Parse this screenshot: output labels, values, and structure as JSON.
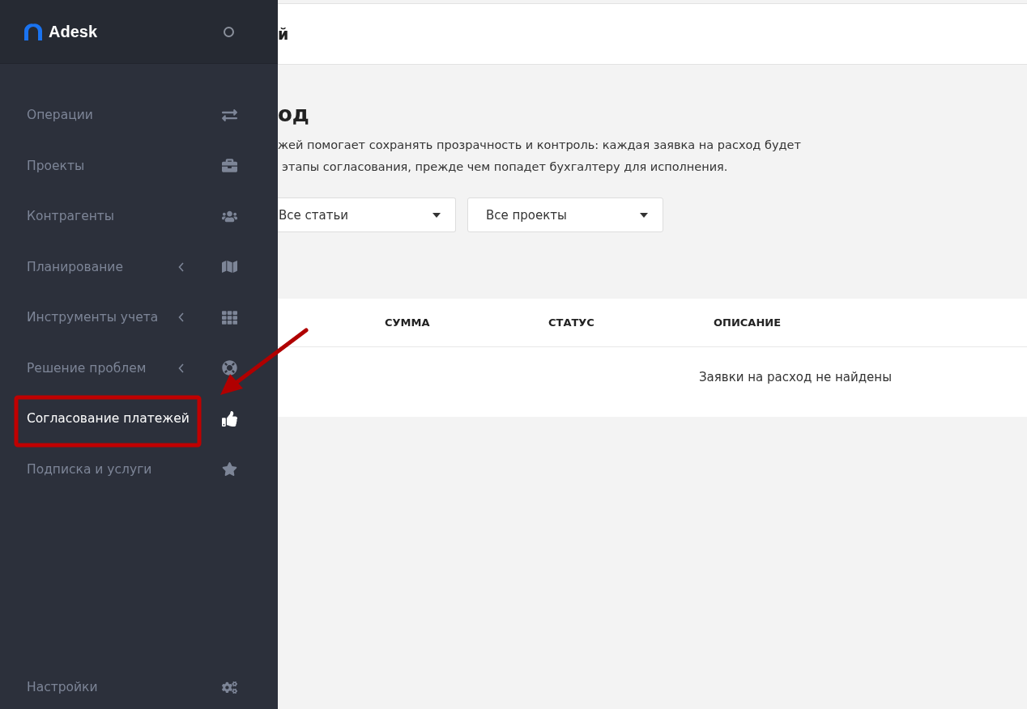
{
  "sidebar": {
    "logo": "Adesk",
    "items": [
      {
        "label": "Операции",
        "has_submenu": false,
        "selected": false
      },
      {
        "label": "Проекты",
        "has_submenu": false,
        "selected": false
      },
      {
        "label": "Контрагенты",
        "has_submenu": false,
        "selected": false
      },
      {
        "label": "Планирование",
        "has_submenu": true,
        "selected": false
      },
      {
        "label": "Инструменты учета",
        "has_submenu": true,
        "selected": false
      },
      {
        "label": "Решение проблем",
        "has_submenu": true,
        "selected": false
      },
      {
        "label": "Согласование платежей",
        "has_submenu": false,
        "selected": true
      },
      {
        "label": "Подписка и услуги",
        "has_submenu": false,
        "selected": false
      }
    ],
    "footer_item": {
      "label": "Настройки"
    }
  },
  "header": {
    "title": "й"
  },
  "page": {
    "title": "од",
    "description": [
      "жей помогает сохранять прозрачность и контроль: каждая заявка на расход будет",
      "этапы согласования, прежде чем попадет бухгалтеру для исполнения."
    ]
  },
  "filters": [
    {
      "value": "Все статьи"
    },
    {
      "value": "Все проекты"
    }
  ],
  "table": {
    "columns": [
      "СУММА",
      "СТАТУС",
      "ОПИСАНИЕ"
    ],
    "empty_message": "Заявки на расход не найдены"
  }
}
